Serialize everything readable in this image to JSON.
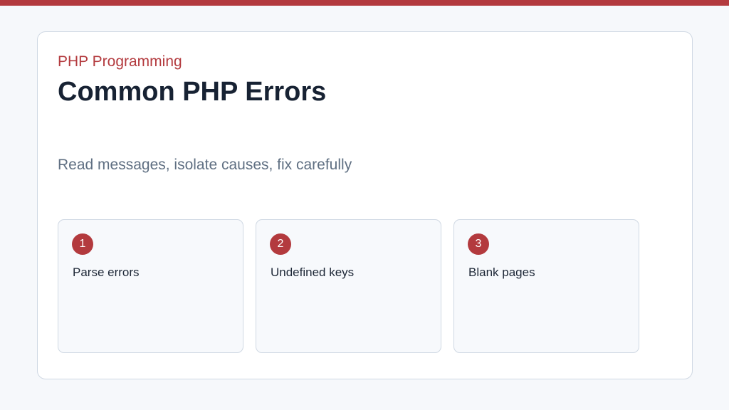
{
  "colors": {
    "accent": "#b33a3e",
    "background": "#f6f8fb",
    "card": "#ffffff",
    "border": "#cfd8e3",
    "title": "#172233",
    "subtitle": "#5f6f82"
  },
  "header": {
    "eyebrow": "PHP Programming",
    "title": "Common PHP Errors",
    "subtitle": "Read messages, isolate causes, fix carefully"
  },
  "items": [
    {
      "number": "1",
      "label": "Parse errors"
    },
    {
      "number": "2",
      "label": "Undefined keys"
    },
    {
      "number": "3",
      "label": "Blank pages"
    }
  ]
}
